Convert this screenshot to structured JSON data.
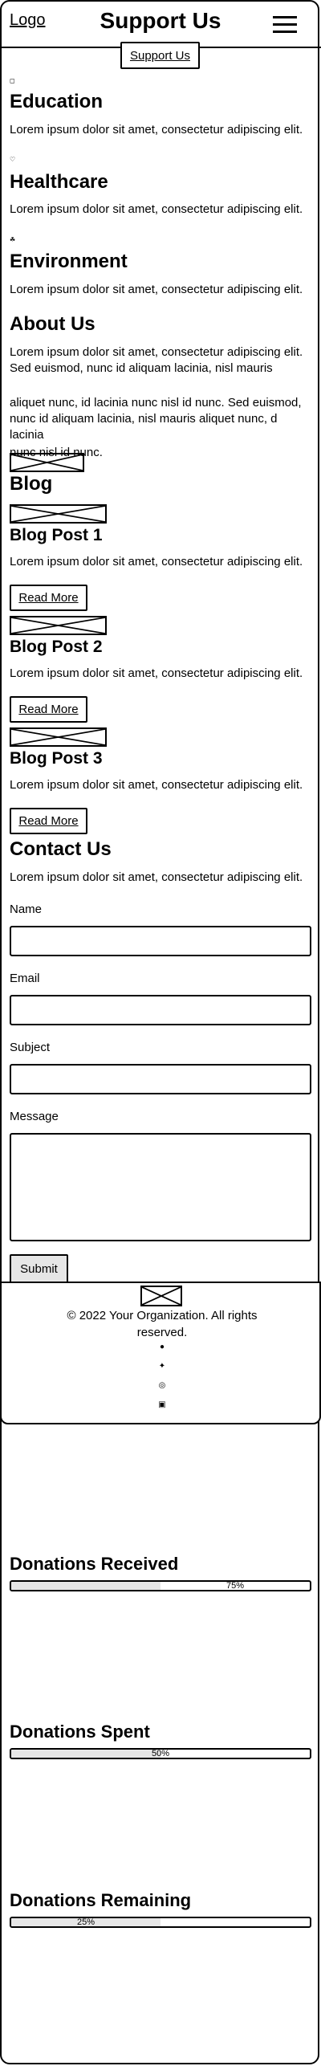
{
  "header": {
    "logo": "Logo",
    "title": "Support Us",
    "menu_icon": "hamburger-menu-icon"
  },
  "hero": {
    "support_button": "Support Us"
  },
  "causes": [
    {
      "icon": "book-icon",
      "title": "Education",
      "text": "Lorem ipsum dolor sit amet, consectetur adipiscing elit."
    },
    {
      "icon": "heart-icon",
      "title": "Healthcare",
      "text": "Lorem ipsum dolor sit amet, consectetur adipiscing elit."
    },
    {
      "icon": "leaf-icon",
      "title": "Environment",
      "text": "Lorem ipsum dolor sit amet, consectetur adipiscing elit."
    }
  ],
  "about": {
    "title": "About Us",
    "p1": "Lorem ipsum dolor sit amet, consectetur adipiscing elit. Sed euismod, nunc id aliquam lacinia, nisl mauris",
    "p2": "aliquet nunc, id lacinia nunc nisl id nunc. Sed euismod, nunc id aliquam lacinia, nisl mauris aliquet nunc, d lacinia",
    "p3": "nunc nisl id nunc."
  },
  "blog": {
    "title": "Blog",
    "posts": [
      {
        "title": "Blog Post 1",
        "text": "Lorem ipsum dolor sit amet, consectetur adipiscing elit.",
        "button": "Read More"
      },
      {
        "title": "Blog Post 2",
        "text": "Lorem ipsum dolor sit amet, consectetur adipiscing elit.",
        "button": "Read More"
      },
      {
        "title": "Blog Post 3",
        "text": "Lorem ipsum dolor sit amet, consectetur adipiscing elit.",
        "button": "Read More"
      }
    ]
  },
  "contact": {
    "title": "Contact Us",
    "text": "Lorem ipsum dolor sit amet, consectetur adipiscing elit.",
    "name_label": "Name",
    "email_label": "Email",
    "subject_label": "Subject",
    "message_label": "Message",
    "submit": "Submit"
  },
  "footer": {
    "copyright": "© 2022 Your Organization. All rights reserved.",
    "social_icons": [
      "facebook-icon",
      "twitter-icon",
      "instagram-icon",
      "linkedin-icon"
    ]
  },
  "stats": [
    {
      "title": "Donations Received",
      "percent": 75,
      "label": "75%"
    },
    {
      "title": "Donations Spent",
      "percent": 50,
      "label": "50%"
    },
    {
      "title": "Donations Remaining",
      "percent": 25,
      "label": "25%"
    }
  ]
}
